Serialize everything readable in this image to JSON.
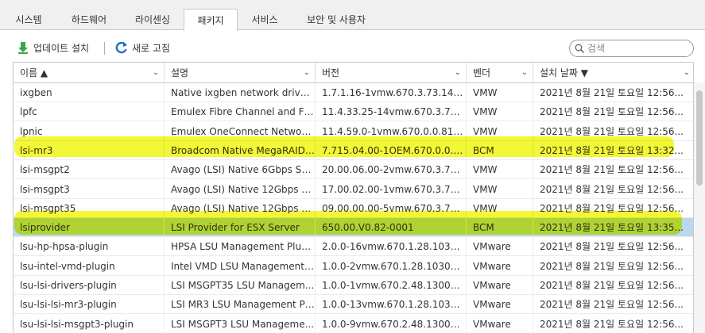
{
  "tabs": [
    {
      "label": "시스템",
      "active": false
    },
    {
      "label": "하드웨어",
      "active": false
    },
    {
      "label": "라이센싱",
      "active": false
    },
    {
      "label": "패키지",
      "active": true
    },
    {
      "label": "서비스",
      "active": false
    },
    {
      "label": "보안 및 사용자",
      "active": false
    }
  ],
  "toolbar": {
    "update_label": "업데이트 설치",
    "refresh_label": "새로 고침",
    "update_icon": "download-arrow-icon",
    "refresh_icon": "refresh-icon"
  },
  "search": {
    "placeholder": "검색",
    "value": ""
  },
  "columns": [
    {
      "label": "이름 ▲"
    },
    {
      "label": "설명"
    },
    {
      "label": "버전"
    },
    {
      "label": "벤더"
    },
    {
      "label": "설치 날짜 ▼"
    }
  ],
  "rows": [
    {
      "name": "ixgben",
      "desc": "Native ixgben network driver f...",
      "version": "1.7.1.16-1vmw.670.3.73.1432...",
      "vendor": "VMW",
      "date": "2021년 8월 21일 토요일 12:56..."
    },
    {
      "name": "lpfc",
      "desc": "Emulex Fibre Channel and FC...",
      "version": "11.4.33.25-14vmw.670.3.73.1...",
      "vendor": "VMW",
      "date": "2021년 8월 21일 토요일 12:56..."
    },
    {
      "name": "lpnic",
      "desc": "Emulex OneConnect Network ...",
      "version": "11.4.59.0-1vmw.670.0.0.8169...",
      "vendor": "VMW",
      "date": "2021년 8월 21일 토요일 12:56..."
    },
    {
      "name": "lsi-mr3",
      "desc": "Broadcom Native MegaRAID ...",
      "version": "7.715.04.00-1OEM.670.0.0.81...",
      "vendor": "BCM",
      "date": "2021년 8월 21일 토요일 13:32..."
    },
    {
      "name": "lsi-msgpt2",
      "desc": "Avago (LSI) Native 6Gbps SA...",
      "version": "20.00.06.00-2vmw.670.3.73.1...",
      "vendor": "VMW",
      "date": "2021년 8월 21일 토요일 12:56..."
    },
    {
      "name": "lsi-msgpt3",
      "desc": "Avago (LSI) Native 12Gbps S...",
      "version": "17.00.02.00-1vmw.670.3.73.1...",
      "vendor": "VMW",
      "date": "2021년 8월 21일 토요일 12:56..."
    },
    {
      "name": "lsi-msgpt35",
      "desc": "Avago (LSI) Native 12Gbps S...",
      "version": "09.00.00.00-5vmw.670.3.73.1...",
      "vendor": "VMW",
      "date": "2021년 8월 21일 토요일 12:56..."
    },
    {
      "name": "lsiprovider",
      "desc": "LSI Provider for ESX Server",
      "version": "650.00.V0.82-0001",
      "vendor": "BCM",
      "date": "2021년 8월 21일 토요일 13:35...",
      "selected": true
    },
    {
      "name": "lsu-hp-hpsa-plugin",
      "desc": "HPSA LSU Management Plugin",
      "version": "2.0.0-16vmw.670.1.28.103026...",
      "vendor": "VMware",
      "date": "2021년 8월 21일 토요일 12:56..."
    },
    {
      "name": "lsu-intel-vmd-plugin",
      "desc": "Intel VMD LSU Management ...",
      "version": "1.0.0-2vmw.670.1.28.10302608",
      "vendor": "VMware",
      "date": "2021년 8월 21일 토요일 12:56..."
    },
    {
      "name": "lsu-lsi-drivers-plugin",
      "desc": "LSI MSGPT35 LSU Managem...",
      "version": "1.0.0-1vmw.670.2.48.13006603",
      "vendor": "VMware",
      "date": "2021년 8월 21일 토요일 12:56..."
    },
    {
      "name": "lsu-lsi-lsi-mr3-plugin",
      "desc": "LSI MR3 LSU Management Pl...",
      "version": "1.0.0-13vmw.670.1.28.103026...",
      "vendor": "VMware",
      "date": "2021년 8월 21일 토요일 12:56..."
    },
    {
      "name": "lsu-lsi-lsi-msgpt3-plugin",
      "desc": "LSI MSGPT3 LSU Manageme...",
      "version": "1.0.0-9vmw.670.2.48.13006603",
      "vendor": "VMware",
      "date": "2021년 8월 21일 토요일 12:56..."
    }
  ]
}
